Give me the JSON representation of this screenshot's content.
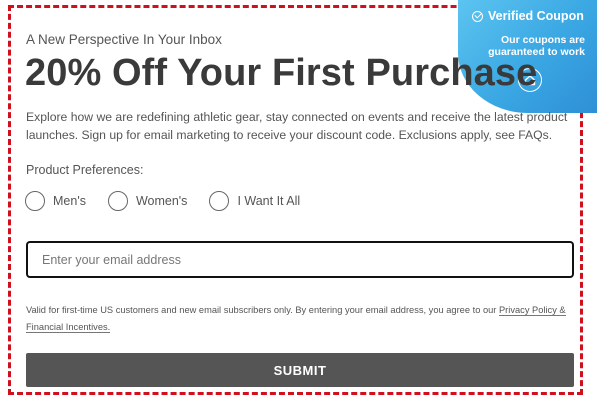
{
  "badge": {
    "title": "Verified Coupon",
    "text": "Our coupons are guaranteed to work",
    "check_icon": "check-circle-icon",
    "home_icon": "home-icon",
    "color": "#3aa7e3"
  },
  "form": {
    "eyebrow": "A New Perspective In Your Inbox",
    "headline": "20% Off Your First Purchase",
    "description": "Explore how we are redefining athletic gear, stay connected on events and receive the latest product launches. Sign up for email marketing to receive your discount code. Exclusions apply, see FAQs.",
    "preferences_label": "Product Preferences:",
    "options": [
      {
        "label": "Men's"
      },
      {
        "label": "Women's"
      },
      {
        "label": "I Want It All"
      }
    ],
    "email": {
      "value": "",
      "placeholder": "Enter your email address"
    },
    "fine_print": "Valid for first-time US customers and new email subscribers only. By entering your email address, you agree to our",
    "privacy_link": "Privacy Policy &",
    "incentives_link": "Financial Incentives.",
    "submit_label": "SUBMIT"
  },
  "colors": {
    "frame_border": "#d0101c",
    "button_bg": "#555555",
    "headline": "#3a3a3a"
  }
}
